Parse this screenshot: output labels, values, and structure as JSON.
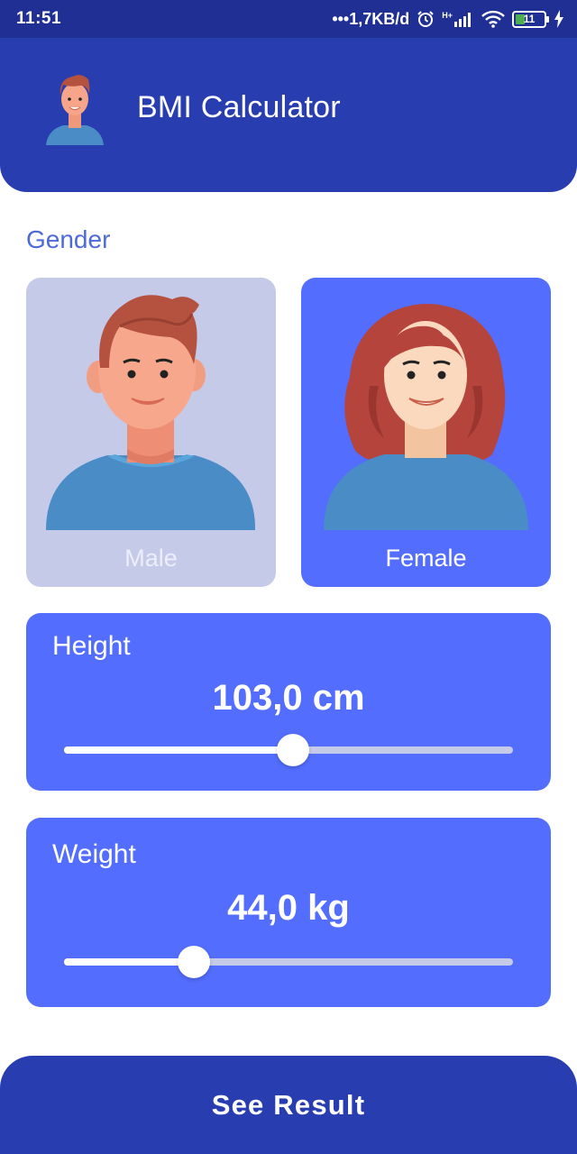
{
  "status_bar": {
    "time": "11:51",
    "network_speed": "•••1,7KB/d",
    "signal_label": "H+",
    "battery_level": "11",
    "icons": [
      "alarm-icon",
      "signal-icon",
      "wifi-icon",
      "battery-icon",
      "charging-icon"
    ]
  },
  "app_bar": {
    "title": "BMI Calculator",
    "avatar_icon": "male-avatar-icon"
  },
  "gender": {
    "label": "Gender",
    "options": [
      {
        "label": "Male",
        "selected": false,
        "icon": "male-portrait-icon"
      },
      {
        "label": "Female",
        "selected": true,
        "icon": "female-portrait-icon"
      }
    ]
  },
  "height": {
    "label": "Height",
    "value_text": "103,0 cm",
    "slider_fraction": 0.51
  },
  "weight": {
    "label": "Weight",
    "value_text": "44,0 kg",
    "slider_fraction": 0.29
  },
  "result_button": {
    "label": "See Result"
  },
  "colors": {
    "status_bar": "#1f2f94",
    "app_bar": "#283db0",
    "accent": "#536dfe",
    "inactive_card": "#c5cae9",
    "gender_label": "#4e6ad8"
  }
}
